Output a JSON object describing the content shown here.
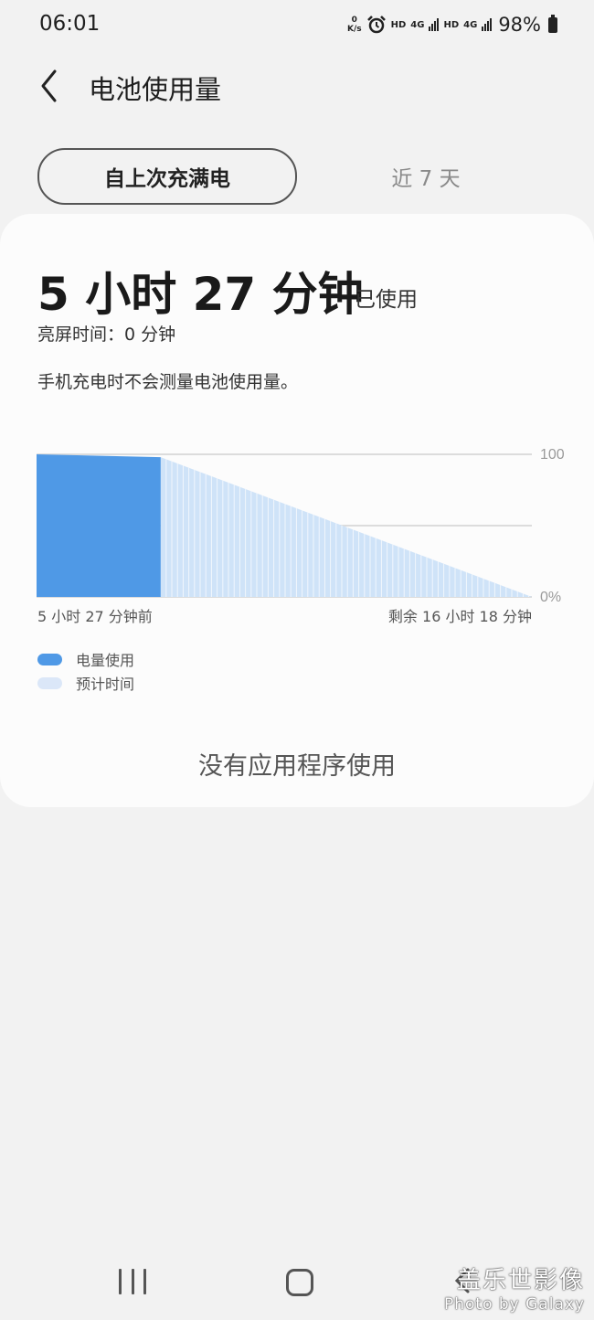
{
  "status_bar": {
    "time": "06:01",
    "net_speed_value": "0",
    "net_speed_unit": "K/s",
    "hd1": "HD",
    "net1": "4G",
    "hd2": "HD",
    "net2": "4G",
    "battery_percent": "98%"
  },
  "header": {
    "title": "电池使用量",
    "back_icon": "chevron-left-icon"
  },
  "tabs": {
    "since_full_charge": "自上次充满电",
    "last_7_days": "近 7 天",
    "selected": "since_full_charge"
  },
  "usage": {
    "used_time": "5 小时 27 分钟",
    "used_suffix": "已使用",
    "screen_on": "亮屏时间：0 分钟",
    "charging_notice": "手机充电时不会测量电池使用量。"
  },
  "chart_data": {
    "type": "area",
    "x_start_label": "5 小时 27 分钟前",
    "x_end_label": "剩余 16 小时 18 分钟",
    "y_ticks": [
      "100",
      "0%"
    ],
    "ylim": [
      0,
      100
    ],
    "grid": true,
    "series": [
      {
        "name": "电量使用",
        "color": "#4f99e6",
        "x_hours": [
          0,
          5.45
        ],
        "values": [
          100,
          98
        ]
      },
      {
        "name": "预计时间",
        "color": "#cfe3f8",
        "x_hours": [
          5.45,
          21.75
        ],
        "values": [
          98,
          0
        ]
      }
    ]
  },
  "legend": {
    "usage_label": "电量使用",
    "estimate_label": "预计时间",
    "usage_color": "#4f99e6",
    "estimate_color": "#dbe7f8"
  },
  "no_apps_text": "没有应用程序使用",
  "nav": {
    "recent_icon": "recent-apps-icon",
    "home_icon": "home-icon",
    "back_icon": "back-icon"
  },
  "watermark": {
    "line1": "盖乐世影像",
    "line2": "Photo by Galaxy"
  }
}
